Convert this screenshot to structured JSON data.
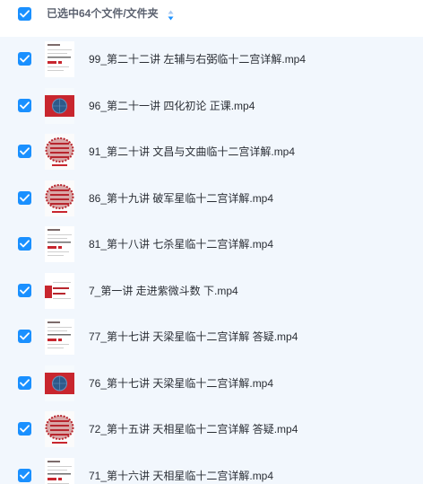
{
  "header": {
    "select_all_label": "已选中64个文件/文件夹",
    "select_all_checked": true,
    "sort_icon": "sort-arrows-icon"
  },
  "colors": {
    "accent": "#1a90ff",
    "list_background": "#f2f7fd",
    "thumb_red": "#c8262e",
    "thumb_globe": "#2d5a8a"
  },
  "files": [
    {
      "name": "99_第二十二讲 左辅与右弼临十二宫详解.mp4",
      "checked": true,
      "thumbnail": "document-thumbnail"
    },
    {
      "name": "96_第二十一讲 四化初论 正课.mp4",
      "checked": true,
      "thumbnail": "red-banner-thumbnail"
    },
    {
      "name": "91_第二十讲 文昌与文曲临十二宫详解.mp4",
      "checked": true,
      "thumbnail": "stamp-thumbnail"
    },
    {
      "name": "86_第十九讲 破军星临十二宫详解.mp4",
      "checked": true,
      "thumbnail": "stamp-thumbnail"
    },
    {
      "name": "81_第十八讲 七杀星临十二宫详解.mp4",
      "checked": true,
      "thumbnail": "document-thumbnail"
    },
    {
      "name": "7_第一讲 走进紫微斗数 下.mp4",
      "checked": true,
      "thumbnail": "mixed-thumbnail"
    },
    {
      "name": "77_第十七讲 天梁星临十二宫详解 答疑.mp4",
      "checked": true,
      "thumbnail": "document-thumbnail"
    },
    {
      "name": "76_第十七讲 天梁星临十二宫详解.mp4",
      "checked": true,
      "thumbnail": "red-banner-thumbnail"
    },
    {
      "name": "72_第十五讲 天相星临十二宫详解 答疑.mp4",
      "checked": true,
      "thumbnail": "stamp-thumbnail"
    },
    {
      "name": "71_第十六讲 天相星临十二宫详解.mp4",
      "checked": true,
      "thumbnail": "document-thumbnail"
    }
  ]
}
